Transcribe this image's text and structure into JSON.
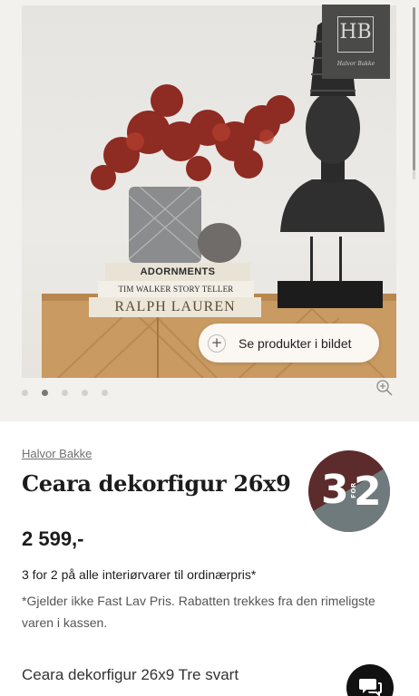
{
  "gallery": {
    "book_spines": [
      "ADORNMENTS",
      "TIM WALKER STORY TELLER",
      "RALPH LAUREN"
    ],
    "brand_logo": {
      "monogram": "HB",
      "signature": "Halvor Bakke"
    },
    "see_products_label": "Se produkter i bildet",
    "dots": 5,
    "active_dot": 2
  },
  "product": {
    "brand": "Halvor Bakke",
    "title": "Ceara dekorfigur 26x9",
    "badge": {
      "left": "3",
      "for": "FOR",
      "right": "2"
    },
    "price": "2 599,-",
    "promo": "3 for 2 på alle interiørvarer til ordinærpris*",
    "note": "*Gjelder ikke Fast Lav Pris. Rabatten trekkes fra den rimeligste varen i kassen.",
    "variant": "Ceara dekorfigur 26x9 Tre svart"
  },
  "colors": {
    "badge_top": "#5c2b2b",
    "badge_bottom": "#6f7a7d",
    "chat_button": "#111111"
  }
}
